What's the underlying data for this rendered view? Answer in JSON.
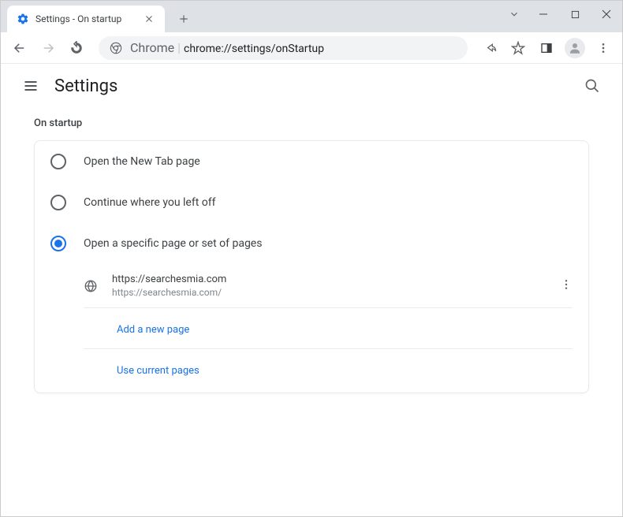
{
  "window": {
    "tab_title": "Settings - On startup"
  },
  "toolbar": {
    "url_prefix": "Chrome",
    "url_path": "chrome://settings/onStartup"
  },
  "header": {
    "title": "Settings"
  },
  "section": {
    "title": "On startup",
    "options": {
      "new_tab": "Open the New Tab page",
      "continue": "Continue where you left off",
      "specific": "Open a specific page or set of pages"
    },
    "selected": "specific",
    "pages": [
      {
        "title": "https://searchesmia.com",
        "url": "https://searchesmia.com/"
      }
    ],
    "add_page": "Add a new page",
    "use_current": "Use current pages"
  }
}
